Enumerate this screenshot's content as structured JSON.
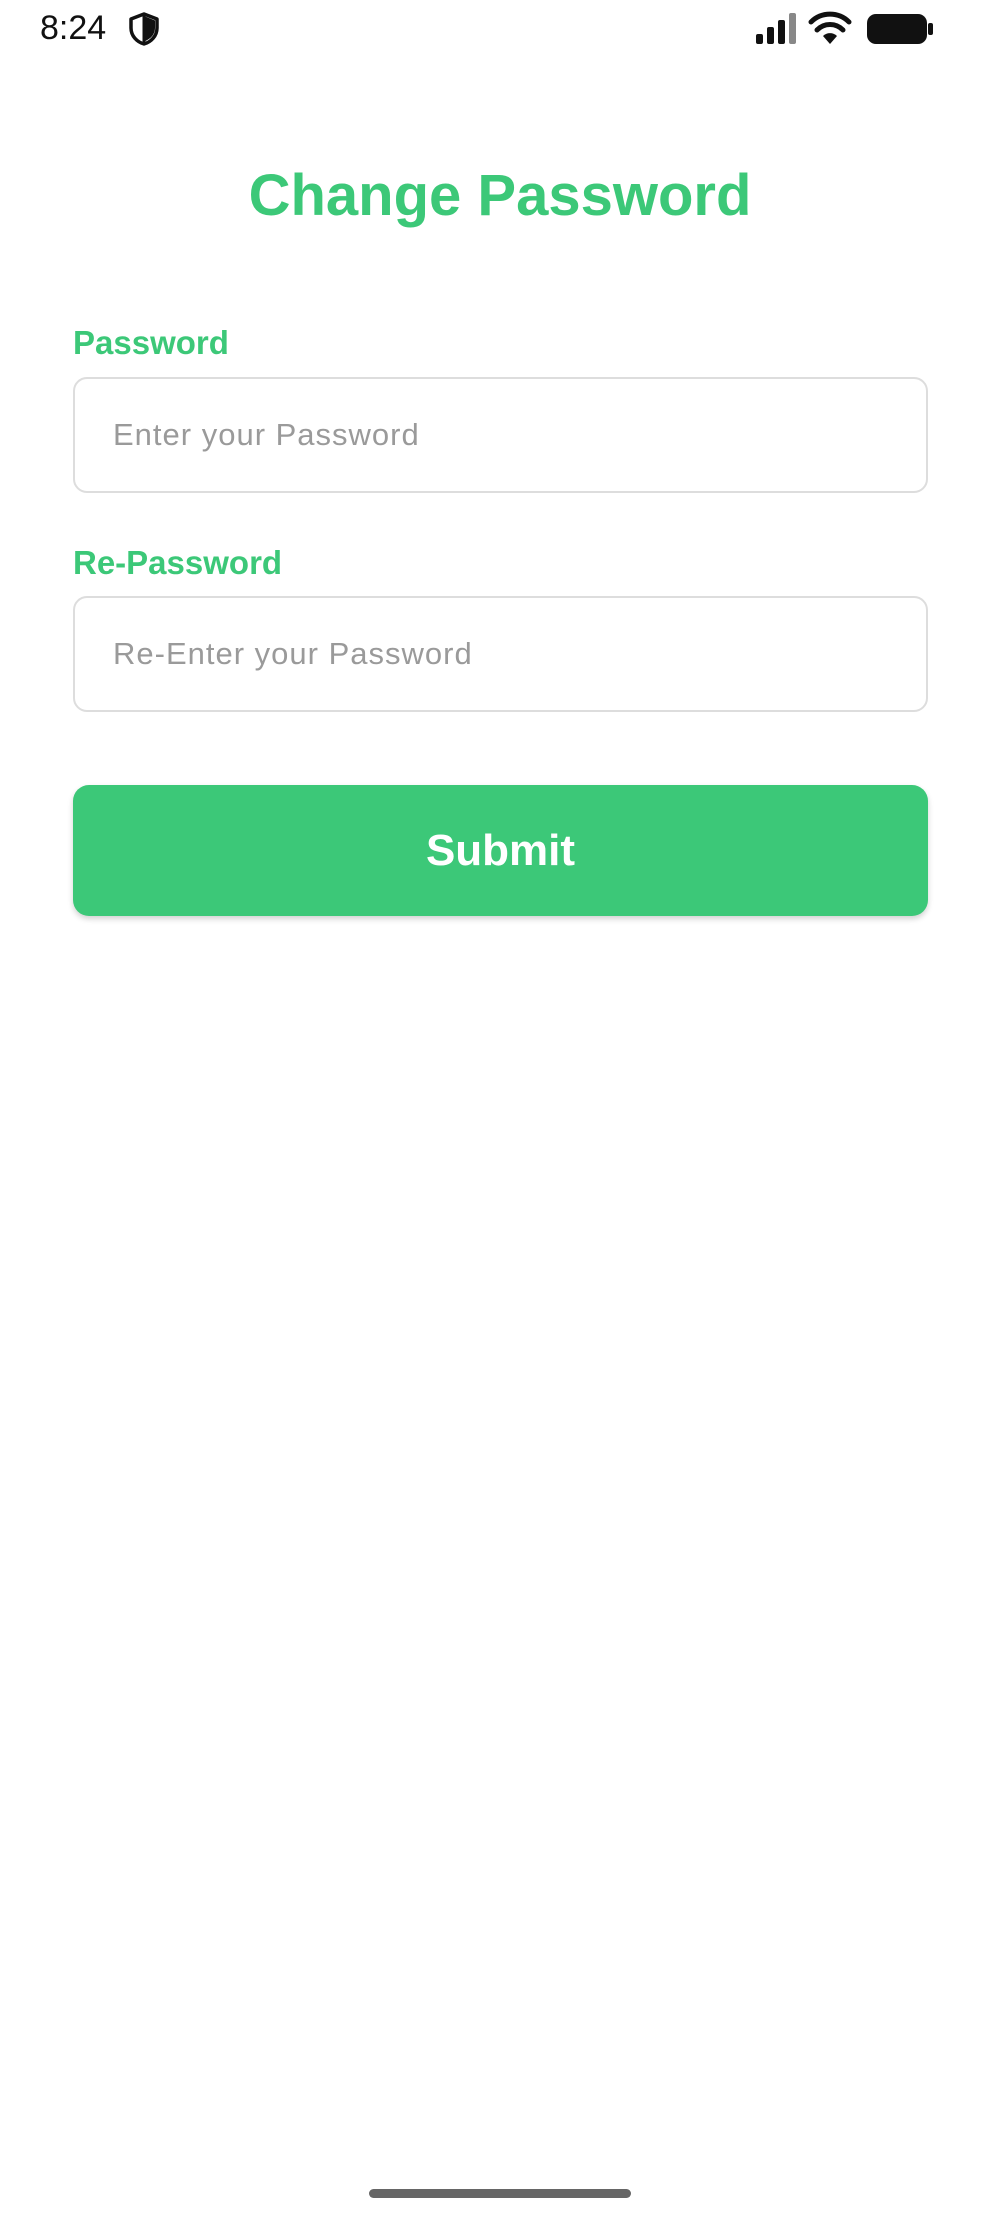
{
  "status_bar": {
    "time": "8:24",
    "icons": [
      "shield-icon",
      "signal-icon",
      "wifi-icon",
      "battery-icon"
    ]
  },
  "page": {
    "title": "Change Password"
  },
  "form": {
    "password": {
      "label": "Password",
      "value": "",
      "placeholder": "Enter your Password"
    },
    "repassword": {
      "label": "Re-Password",
      "value": "",
      "placeholder": "Re-Enter your Password"
    },
    "submit_label": "Submit"
  },
  "colors": {
    "accent": "#3cc878",
    "input_border": "#dddddd",
    "placeholder": "#9a9a9a",
    "background": "#ffffff"
  }
}
